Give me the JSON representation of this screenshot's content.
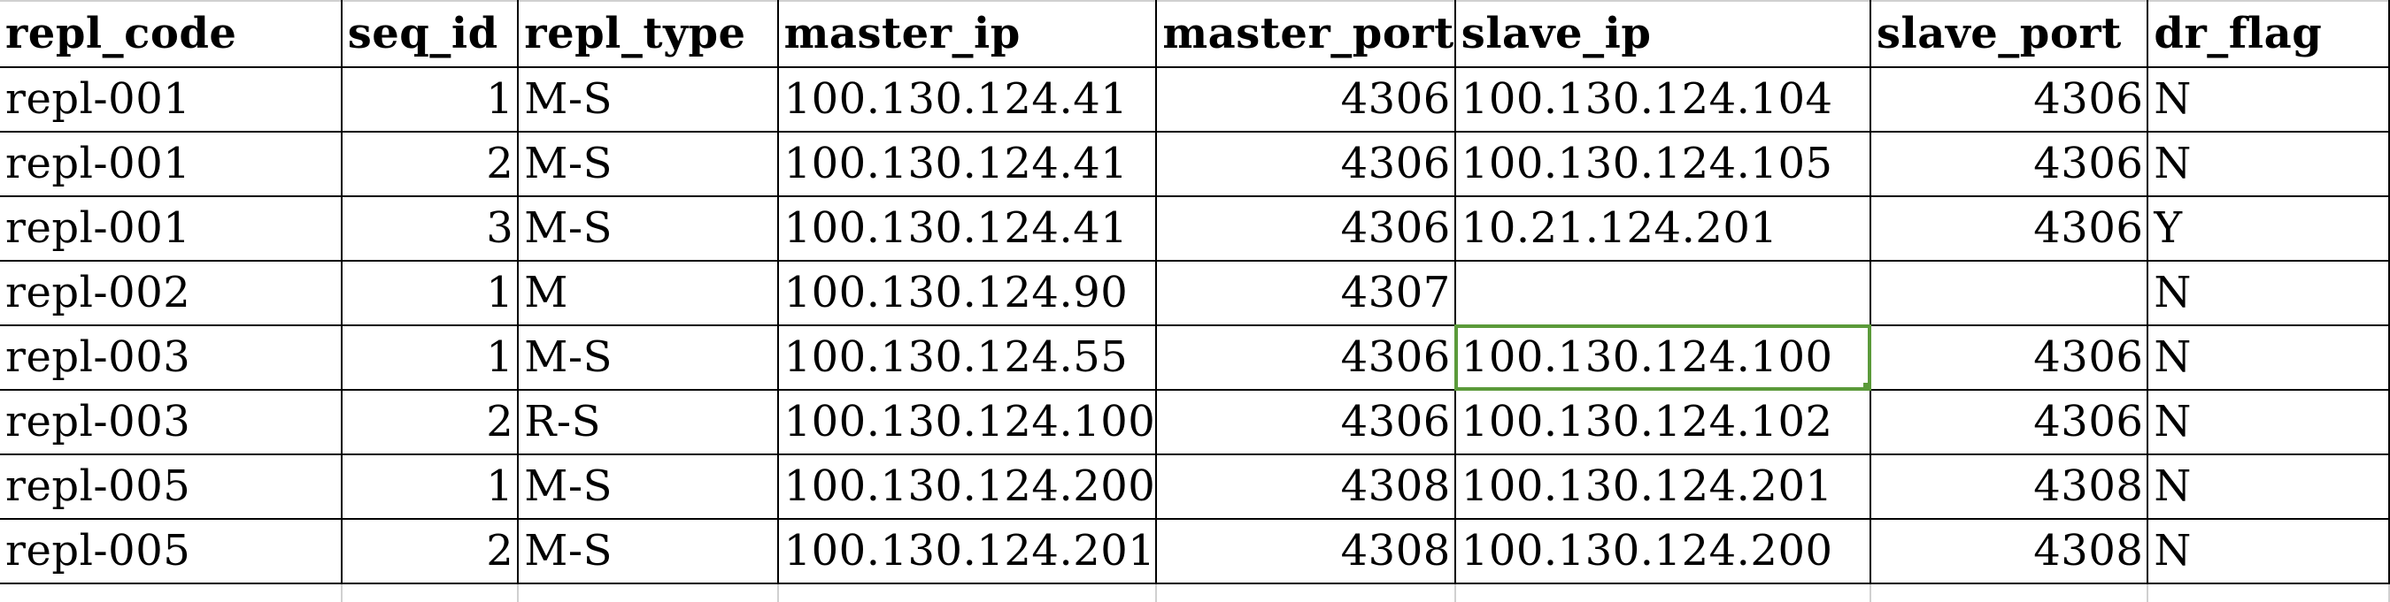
{
  "sheet": {
    "columns": [
      "repl_code",
      "seq_id",
      "repl_type",
      "master_ip",
      "master_port",
      "slave_ip",
      "slave_port",
      "dr_flag"
    ],
    "rows": [
      [
        "repl-001",
        "1",
        "M-S",
        "100.130.124.41",
        "4306",
        "100.130.124.104",
        "4306",
        "N"
      ],
      [
        "repl-001",
        "2",
        "M-S",
        "100.130.124.41",
        "4306",
        "100.130.124.105",
        "4306",
        "N"
      ],
      [
        "repl-001",
        "3",
        "M-S",
        "100.130.124.41",
        "4306",
        "10.21.124.201",
        "4306",
        "Y"
      ],
      [
        "repl-002",
        "1",
        "M",
        "100.130.124.90",
        "4307",
        "",
        "",
        "N"
      ],
      [
        "repl-003",
        "1",
        "M-S",
        "100.130.124.55",
        "4306",
        "100.130.124.100",
        "4306",
        "N"
      ],
      [
        "repl-003",
        "2",
        "R-S",
        "100.130.124.100",
        "4306",
        "100.130.124.102",
        "4306",
        "N"
      ],
      [
        "repl-005",
        "1",
        "M-S",
        "100.130.124.200",
        "4308",
        "100.130.124.201",
        "4308",
        "N"
      ],
      [
        "repl-005",
        "2",
        "M-S",
        "100.130.124.201",
        "4308",
        "100.130.124.200",
        "4308",
        "N"
      ]
    ],
    "selected_cell": "slave_ip of row 5",
    "selection_color": "#5b9a3a"
  }
}
